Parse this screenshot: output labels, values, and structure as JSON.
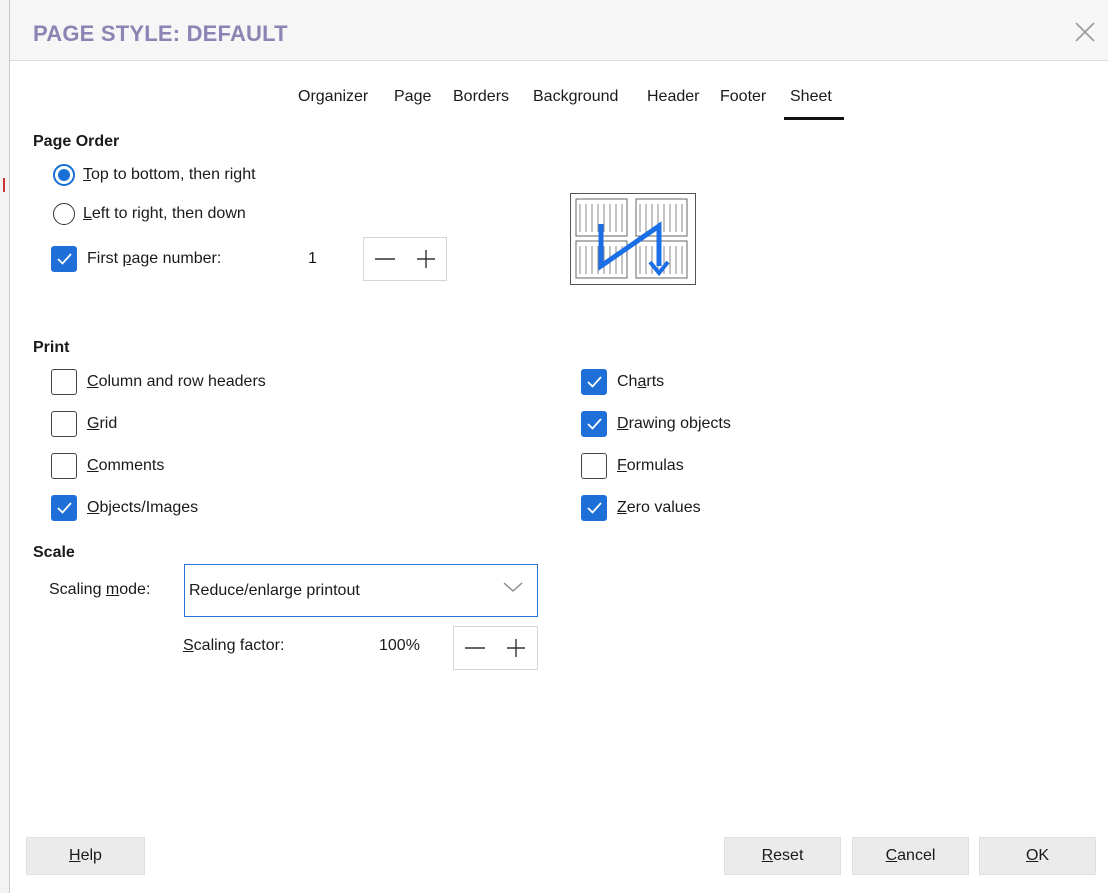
{
  "dialog": {
    "title": "PAGE STYLE: DEFAULT"
  },
  "tabs": [
    {
      "label": "Organizer"
    },
    {
      "label": "Page"
    },
    {
      "label": "Borders"
    },
    {
      "label": "Background"
    },
    {
      "label": "Header"
    },
    {
      "label": "Footer"
    },
    {
      "label": "Sheet",
      "active": true
    }
  ],
  "page_order": {
    "heading": "Page Order",
    "top_to_bottom": {
      "accel": "T",
      "rest": "op to bottom, then right",
      "checked": true
    },
    "left_to_right": {
      "accel": "L",
      "rest": "eft to right, then down",
      "checked": false
    },
    "first_page": {
      "pre": "First ",
      "accel": "p",
      "rest": "age number:",
      "checked": true,
      "value": "1"
    }
  },
  "print": {
    "heading": "Print",
    "column_row_headers": {
      "accel": "C",
      "rest": "olumn and row headers",
      "checked": false
    },
    "grid": {
      "accel": "G",
      "rest": "rid",
      "checked": false
    },
    "comments": {
      "accel": "C",
      "rest": "omments",
      "checked": false
    },
    "objects_images": {
      "accel": "O",
      "rest": "bjects/Images",
      "checked": true
    },
    "charts": {
      "pre": "Ch",
      "accel": "a",
      "rest": "rts",
      "checked": true
    },
    "drawing_objects": {
      "accel": "D",
      "rest": "rawing objects",
      "checked": true
    },
    "formulas": {
      "accel": "F",
      "rest": "ormulas",
      "checked": false
    },
    "zero_values": {
      "accel": "Z",
      "rest": "ero values",
      "checked": true
    }
  },
  "scale": {
    "heading": "Scale",
    "mode_label": {
      "pre": "Scaling ",
      "accel": "m",
      "rest": "ode:"
    },
    "mode_value": "Reduce/enlarge printout",
    "factor_label": {
      "accel": "S",
      "rest": "caling factor:"
    },
    "factor_value": "100%"
  },
  "buttons": {
    "help": {
      "accel": "H",
      "rest": "elp"
    },
    "reset": {
      "accel": "R",
      "rest": "eset"
    },
    "cancel": {
      "accel": "C",
      "rest": "ancel"
    },
    "ok": {
      "accel": "O",
      "rest": "K"
    }
  },
  "colors": {
    "title": "#8b85b4",
    "accent": "#1e6fd8"
  }
}
